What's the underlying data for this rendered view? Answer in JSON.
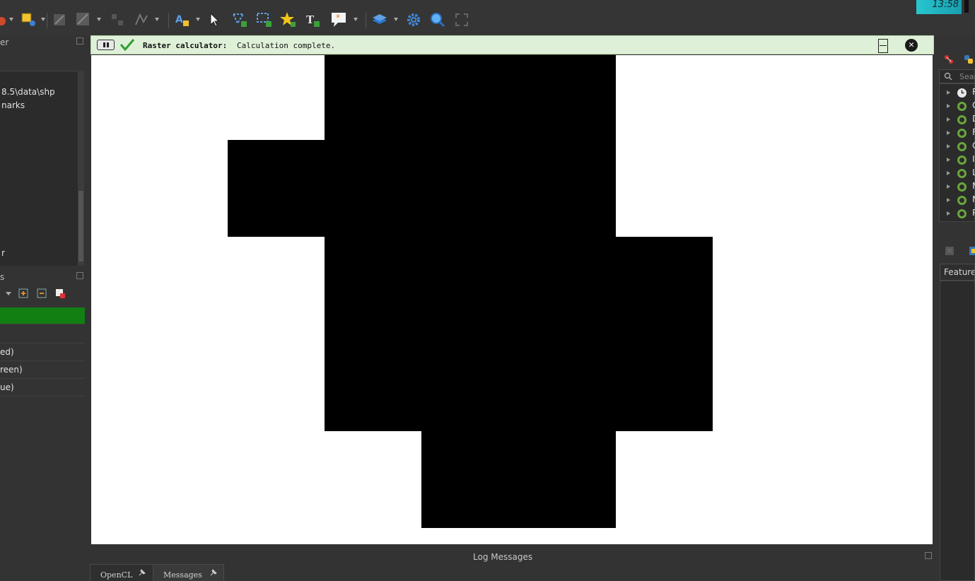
{
  "clock": {
    "time": "13:58"
  },
  "message_bar": {
    "title": "Raster calculator:",
    "text": "Calculation complete.",
    "close_symbol": "✕",
    "status": "success"
  },
  "browser_panel": {
    "title_fragment": "er",
    "items": [
      "8.5\\data\\shp",
      "narks",
      "r"
    ]
  },
  "layers_panel": {
    "title_fragment": "s",
    "bands": [
      "ed)",
      "reen)",
      "ue)"
    ]
  },
  "log_panel": {
    "title": "Log Messages",
    "tabs": [
      {
        "label": "OpenCL",
        "active": false
      },
      {
        "label": "Messages",
        "active": true
      }
    ]
  },
  "processing_toolbox": {
    "search_placeholder": "Sear",
    "providers": [
      "R",
      "G",
      "D",
      "F",
      "G",
      "I",
      "L",
      "M",
      "N",
      "P"
    ]
  },
  "feature_panel": {
    "tab_label": "Feature"
  },
  "colors": {
    "success_bg": "#dff0d8",
    "check_green": "#2ea02e",
    "layer_selected": "#127f12",
    "qgis_green": "#6aa63c",
    "raster_value": "#000000",
    "canvas_bg": "#ffffff"
  }
}
